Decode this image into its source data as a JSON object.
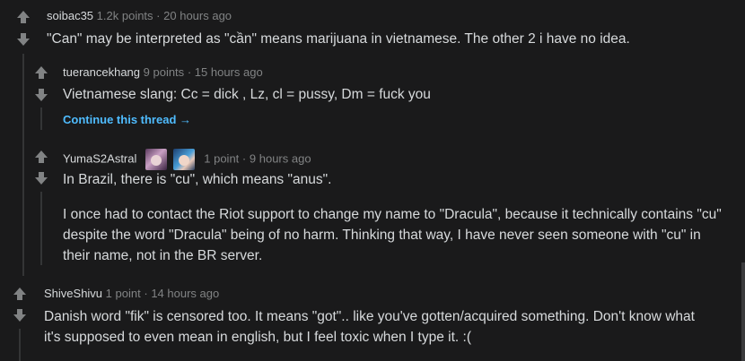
{
  "comments": [
    {
      "author": "soibac35",
      "points": "1.2k points",
      "sep": "·",
      "time": "20 hours ago",
      "body": [
        "\"Can\" may be interpreted as \"cần\" means marijuana in vietnamese. The other 2 i have no idea."
      ]
    },
    {
      "author": "tuerancekhang",
      "points": "9 points",
      "sep": "·",
      "time": "15 hours ago",
      "body": [
        "Vietnamese slang: Cc = dick , Lz, cl = pussy, Dm = fuck you"
      ],
      "continue_label": "Continue this thread",
      "continue_arrow": "→"
    },
    {
      "author": "YumaS2Astral",
      "flair_icons": [
        "champion-portrait-icon",
        "champion-portrait-icon"
      ],
      "points": "1 point",
      "sep": "·",
      "time": "9 hours ago",
      "body": [
        "In Brazil, there is \"cu\", which means \"anus\".",
        "I once had to contact the Riot support to change my name to \"Dracula\", because it technically contains \"cu\" despite the word \"Dracula\" being of no harm. Thinking that way, I have never seen someone with \"cu\" in their name, not in the BR server."
      ]
    },
    {
      "author": "ShiveShivu",
      "points": "1 point",
      "sep": "·",
      "time": "14 hours ago",
      "body": [
        "Danish word \"fik\" is censored too. It means \"got\".. like you've gotten/acquired something. Don't know what it's supposed to even mean in english, but I feel toxic when I type it. :("
      ]
    }
  ],
  "icons": {
    "upvote": "upvote-arrow-icon",
    "downvote": "downvote-arrow-icon"
  },
  "colors": {
    "background": "#1a1a1b",
    "text": "#d7dadc",
    "meta": "#818384",
    "link": "#4fbcff",
    "thread_line": "#343536"
  }
}
